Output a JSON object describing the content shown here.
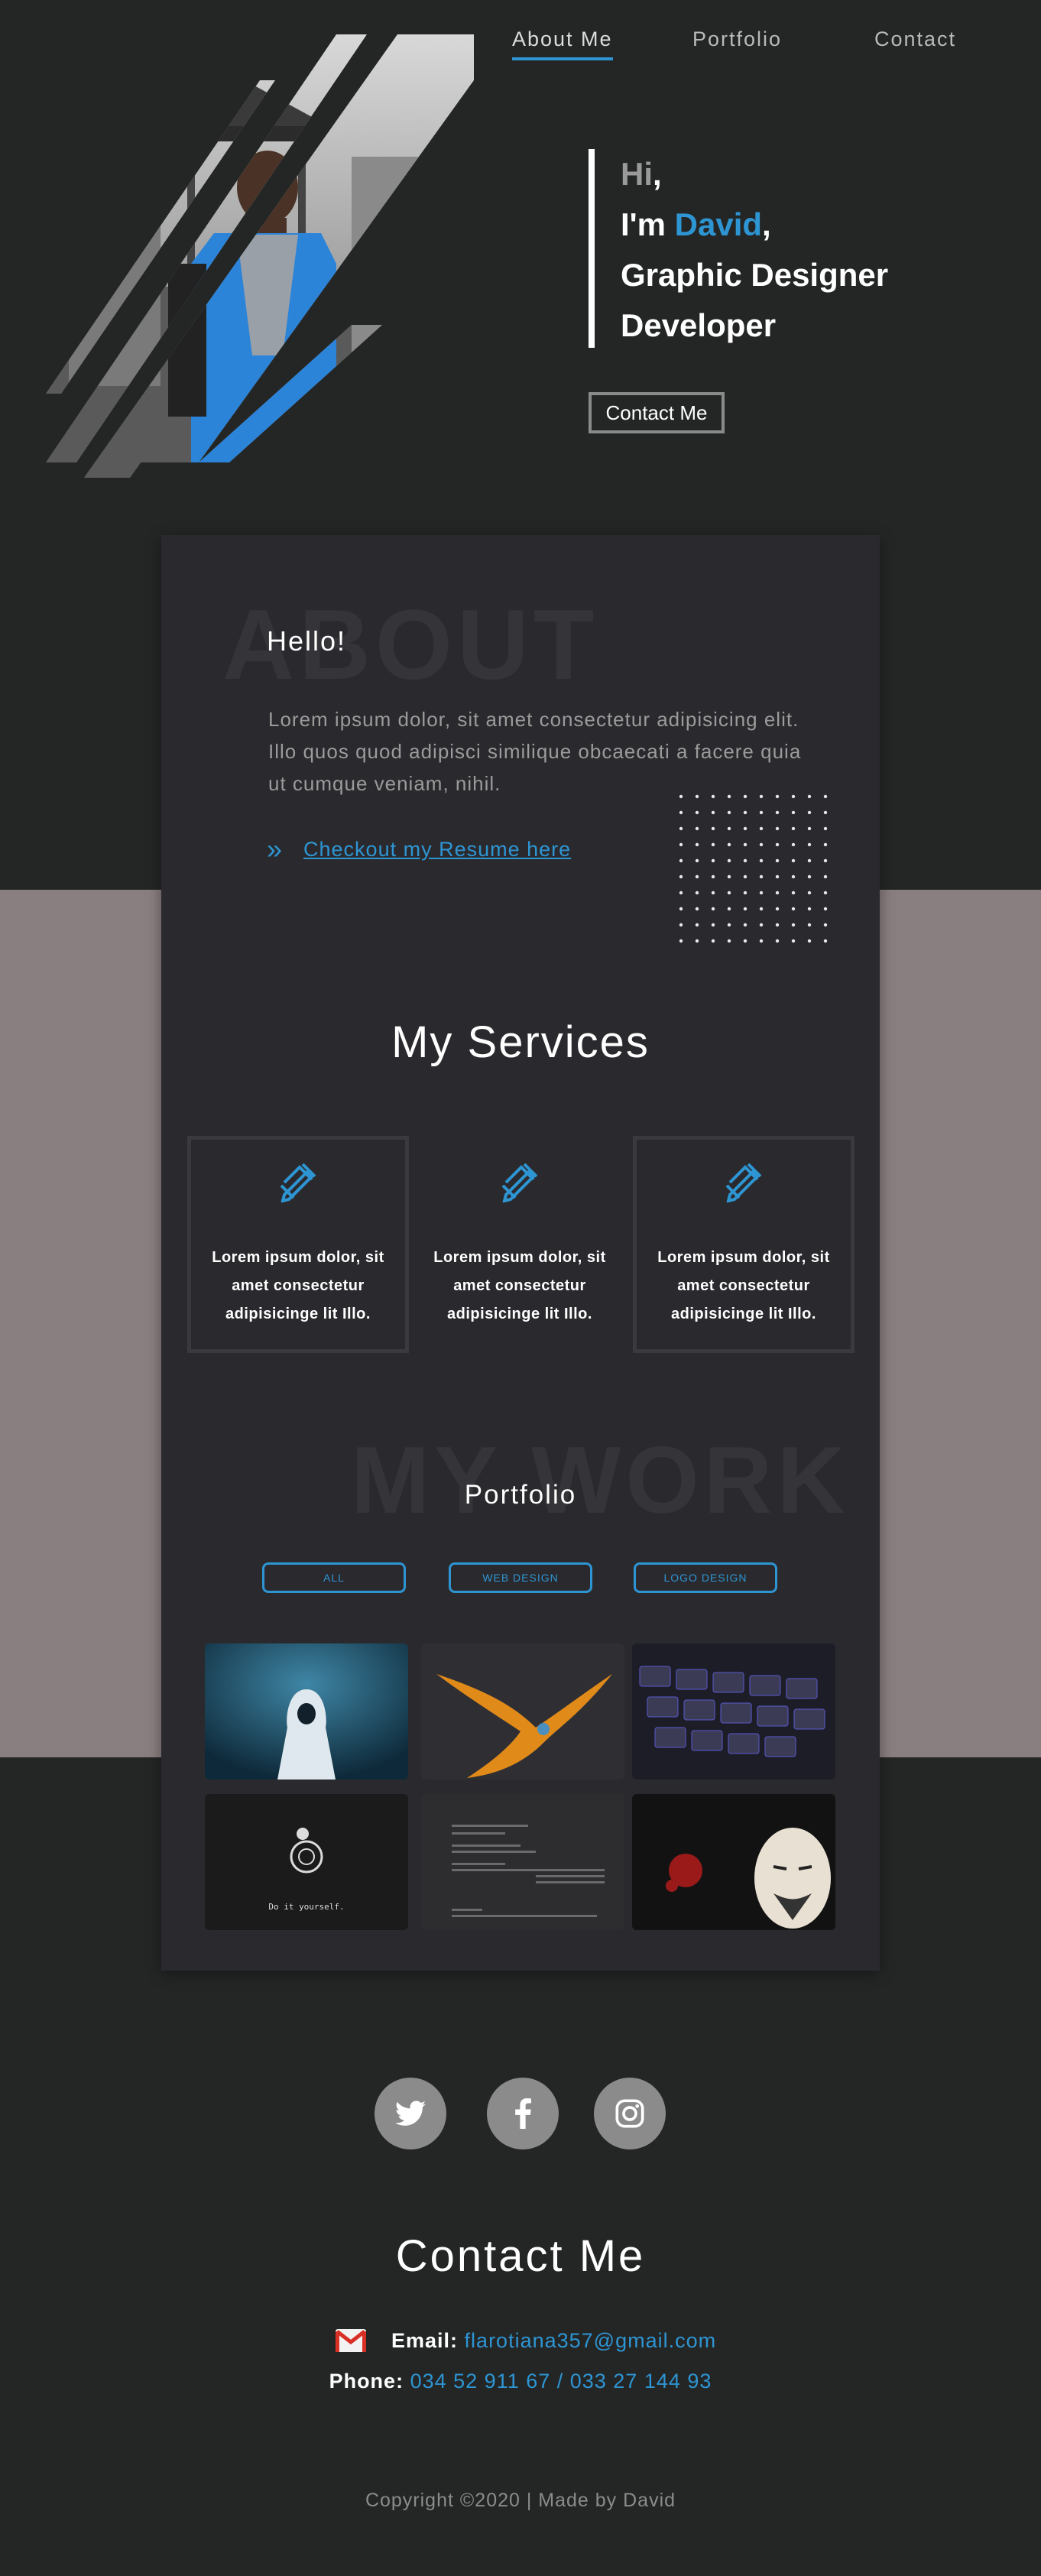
{
  "nav": {
    "items": [
      "About Me",
      "Portfolio",
      "Contact"
    ],
    "active": "About Me"
  },
  "hero": {
    "line1_a": "Hi",
    "line1_b": ",",
    "line2_a": "I'm ",
    "line2_name": "David",
    "line2_b": ",",
    "line3": "Graphic Designer",
    "line4": "Developer",
    "button": "Contact Me"
  },
  "about": {
    "bg_word": "ABOUT",
    "greeting": "Hello!",
    "paragraph": "Lorem ipsum dolor, sit amet consectetur adipisicing elit. Illo quos quod adipisci similique obcaecati a facere quia ut cumque veniam, nihil.",
    "resume_link": "Checkout my Resume here"
  },
  "services": {
    "title": "My Services",
    "items": [
      {
        "icon": "pencil-ruler-icon",
        "text": "Lorem ipsum dolor, sit amet consectetur adipisicinge lit Illo."
      },
      {
        "icon": "pencil-ruler-icon",
        "text": "Lorem ipsum dolor, sit amet consectetur adipisicinge lit Illo."
      },
      {
        "icon": "pencil-ruler-icon",
        "text": "Lorem ipsum dolor, sit amet consectetur adipisicinge lit Illo."
      }
    ]
  },
  "portfolio": {
    "bg_word": "MY WORK",
    "title": "Portfolio",
    "filters": [
      "ALL",
      "WEB DESIGN",
      "LOGO DESIGN"
    ],
    "thumb_caption": "Do it yourself."
  },
  "social": [
    "twitter-icon",
    "facebook-icon",
    "instagram-icon"
  ],
  "contact": {
    "title": "Contact Me",
    "email_label": "Email:",
    "email": "flarotiana357@gmail.com",
    "phone_label": "Phone:",
    "phone": "034 52 911 67 / 033 27 144 93"
  },
  "footer": {
    "copyright": "Copyright ©2020 | Made by David"
  },
  "colors": {
    "accent": "#2e95d3",
    "background": "#242626",
    "card": "#2a2a2e",
    "band": "#8a7f80"
  }
}
